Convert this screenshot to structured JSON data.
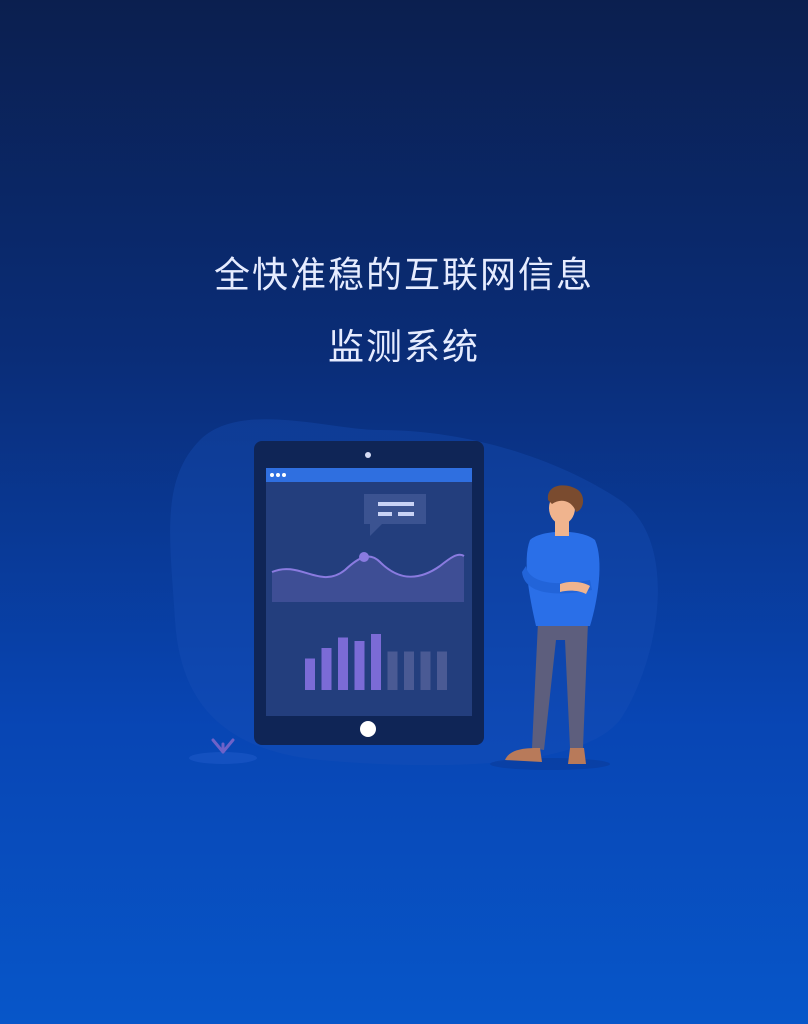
{
  "splash": {
    "headline_line1": "全快准稳的互联网信息",
    "headline_line2": "监测系统"
  },
  "illustration": {
    "subject": "person-with-tablet-dashboard",
    "tablet_chart_bar_levels": [
      0.45,
      0.6,
      0.75,
      0.7,
      0.8,
      0.55,
      0.55,
      0.55,
      0.55
    ]
  },
  "colors": {
    "bg_top": "#0b1f4f",
    "bg_bottom": "#0756c9",
    "text": "#e6ecff",
    "accent_purple": "#7b6bd6"
  }
}
